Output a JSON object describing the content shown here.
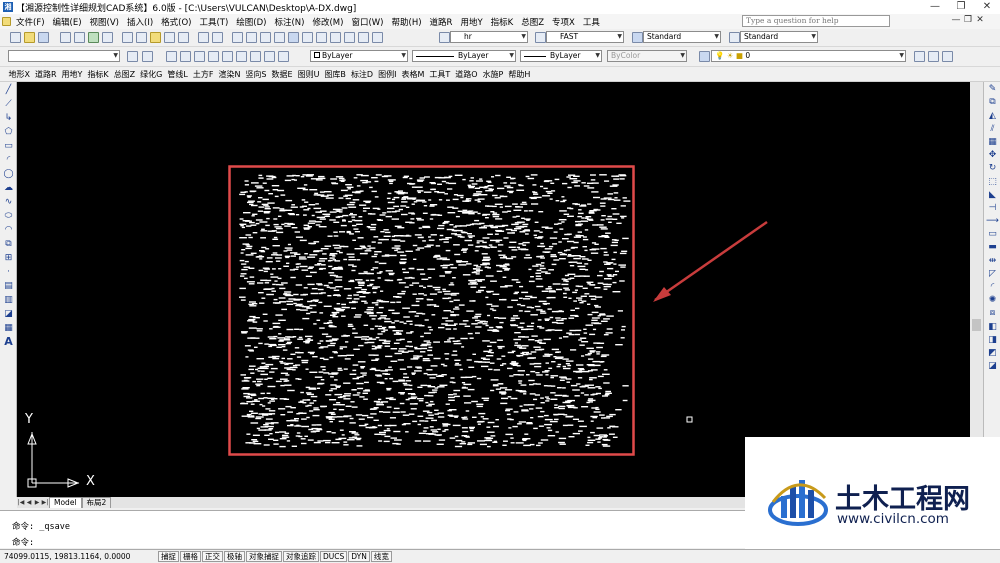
{
  "title": "【湘源控制性详细规划CAD系统】6.0版 - [C:\\Users\\VULCAN\\Desktop\\A-DX.dwg]",
  "window_controls": [
    "—",
    "❐",
    "✕"
  ],
  "menu": [
    "文件(F)",
    "编辑(E)",
    "视图(V)",
    "插入(I)",
    "格式(O)",
    "工具(T)",
    "绘图(D)",
    "标注(N)",
    "修改(M)",
    "窗口(W)",
    "帮助(H)",
    "道路R",
    "用地Y",
    "指标K",
    "总图Z",
    "专项X",
    "工具"
  ],
  "help_placeholder": "Type a question for help",
  "toolbar": {
    "textstyle_font": "hr",
    "linetype_font": "FAST",
    "dimstyle": "Standard",
    "tablestyle": "Standard",
    "layer_color": "ByLayer",
    "layer_linetype": "ByLayer",
    "layer_lineweight": "ByLayer",
    "plotstyle": "ByColor",
    "layer_current": "0"
  },
  "plugin_menu": [
    "地形X",
    "道路R",
    "用地Y",
    "指标K",
    "总图Z",
    "绿化G",
    "管线L",
    "土方F",
    "渲染N",
    "竖向S",
    "数据E",
    "图则U",
    "图库B",
    "标注D",
    "图例I",
    "表格M",
    "工具T",
    "道路O",
    "水施P",
    "帮助H"
  ],
  "ucs": {
    "x": "X",
    "y": "Y"
  },
  "tabs": {
    "model": "Model",
    "layout": "布局2"
  },
  "command": {
    "line1": "命令: _qsave",
    "line2": "命令:"
  },
  "status": {
    "coords": "74099.0115, 19813.1164, 0.0000",
    "buttons": [
      "捕捉",
      "栅格",
      "正交",
      "极轴",
      "对象捕捉",
      "对象追踪",
      "DUCS",
      "DYN",
      "线宽"
    ]
  },
  "watermark": {
    "name": "土木工程网",
    "url": "www.civilcn.com"
  },
  "colors": {
    "canvas": "#000000",
    "highlight_box": "#e04a4a",
    "arrow": "#c83c3c",
    "brand": "#0f2050",
    "logo_blue": "#2a6fd0"
  }
}
